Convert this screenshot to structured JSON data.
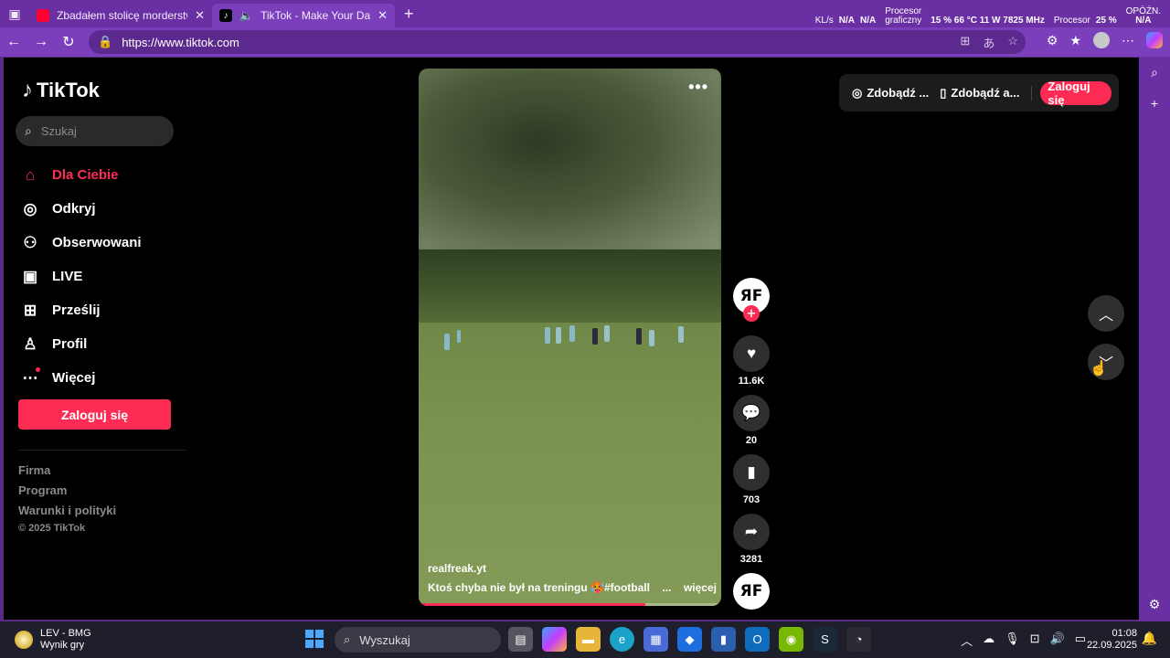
{
  "browser": {
    "tabs": [
      {
        "title": "Zbadałem stolicę morderstw na św",
        "favicon_color": "#ff0033"
      },
      {
        "title": "TikTok - Make Your Day",
        "favicon_color": "#000000"
      }
    ],
    "url": "https://www.tiktok.com",
    "sysinfo": {
      "net_label": "KL/s",
      "net1": "N/A",
      "net2": "N/A",
      "gpu_label_1": "Procesor",
      "gpu_label_2": "graficzny",
      "gpu_values": "15 %  66 °C  11 W  7825 MHz",
      "cpu_label": "Procesor",
      "cpu_value": "25 %",
      "latency_label": "OPÓŹN.",
      "latency_value": "N/A"
    }
  },
  "tiktok": {
    "logo": "TikTok",
    "search_placeholder": "Szukaj",
    "menu": [
      {
        "label": "Dla Ciebie",
        "icon": "home-icon"
      },
      {
        "label": "Odkryj",
        "icon": "compass-icon"
      },
      {
        "label": "Obserwowani",
        "icon": "following-icon"
      },
      {
        "label": "LIVE",
        "icon": "live-icon"
      },
      {
        "label": "Prześlij",
        "icon": "upload-icon"
      },
      {
        "label": "Profil",
        "icon": "profile-icon"
      },
      {
        "label": "Więcej",
        "icon": "more-icon"
      }
    ],
    "login_button": "Zaloguj się",
    "footer": [
      "Firma",
      "Program",
      "Warunki i polityki"
    ],
    "copyright": "© 2025 TikTok",
    "topbar": {
      "pill1": "Zdobądź ...",
      "pill2": "Zdobądź a...",
      "login": "Zaloguj się"
    },
    "video": {
      "author": "realfreak.yt",
      "caption": "Ktoś chyba nie był na treningu 🥵#football",
      "ellipsis": "...",
      "more": "więcej",
      "progress": 0.75
    },
    "actions": {
      "avatar_text": "ЯF",
      "likes": "11.6K",
      "comments": "20",
      "saves": "703",
      "shares": "3281"
    }
  },
  "taskbar": {
    "weather_title": "LEV - BMG",
    "weather_sub": "Wynik gry",
    "search_placeholder": "Wyszukaj",
    "time": "01:08",
    "date": "22.09.2025"
  }
}
